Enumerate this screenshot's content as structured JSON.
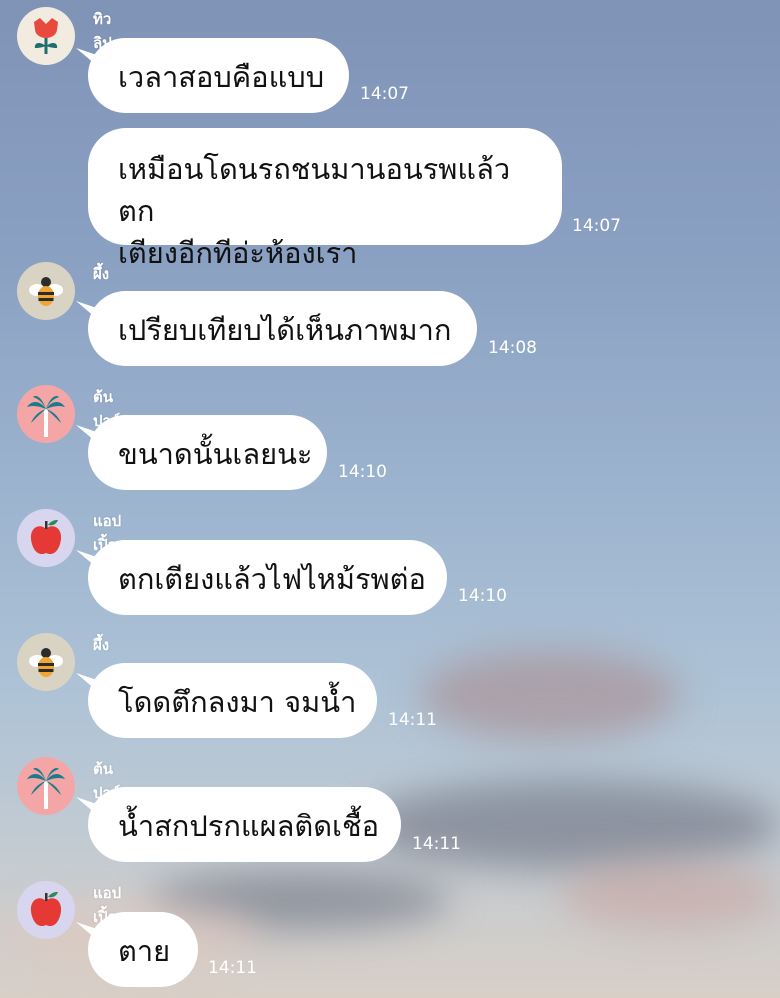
{
  "messages": [
    {
      "sender": "ทิวลิป",
      "avatar": "tulip",
      "text": "เวลาสอบคือแบบ",
      "time": "14:07"
    },
    {
      "sender": "",
      "avatar": "",
      "text": "เหมือนโดนรถชนมานอนรพแล้วตก\nเตียงอีกทีอ่ะห้องเรา",
      "time": "14:07"
    },
    {
      "sender": "ผึ้ง",
      "avatar": "bee",
      "text": "เปรียบเทียบได้เห็นภาพมาก",
      "time": "14:08"
    },
    {
      "sender": "ต้นปาล์ม",
      "avatar": "palm",
      "text": "ขนาดนั้นเลยนะ",
      "time": "14:10"
    },
    {
      "sender": "แอปเปิ้ล",
      "avatar": "apple",
      "text": "ตกเตียงแล้วไฟไหม้รพต่อ",
      "time": "14:10"
    },
    {
      "sender": "ผึ้ง",
      "avatar": "bee",
      "text": "โดดตึกลงมา จมน้ำ",
      "time": "14:11"
    },
    {
      "sender": "ต้นปาล์ม",
      "avatar": "palm",
      "text": "น้ำสกปรกแผลติดเชื้อ",
      "time": "14:11"
    },
    {
      "sender": "แอปเปิ้ล",
      "avatar": "apple",
      "text": "ตาย",
      "time": "14:11"
    }
  ],
  "colors": {
    "tulip_bg": "#f2ece0",
    "bee_bg": "#d9d3c3",
    "palm_bg": "#f4a6a6",
    "apple_bg": "#d7d6ee"
  }
}
